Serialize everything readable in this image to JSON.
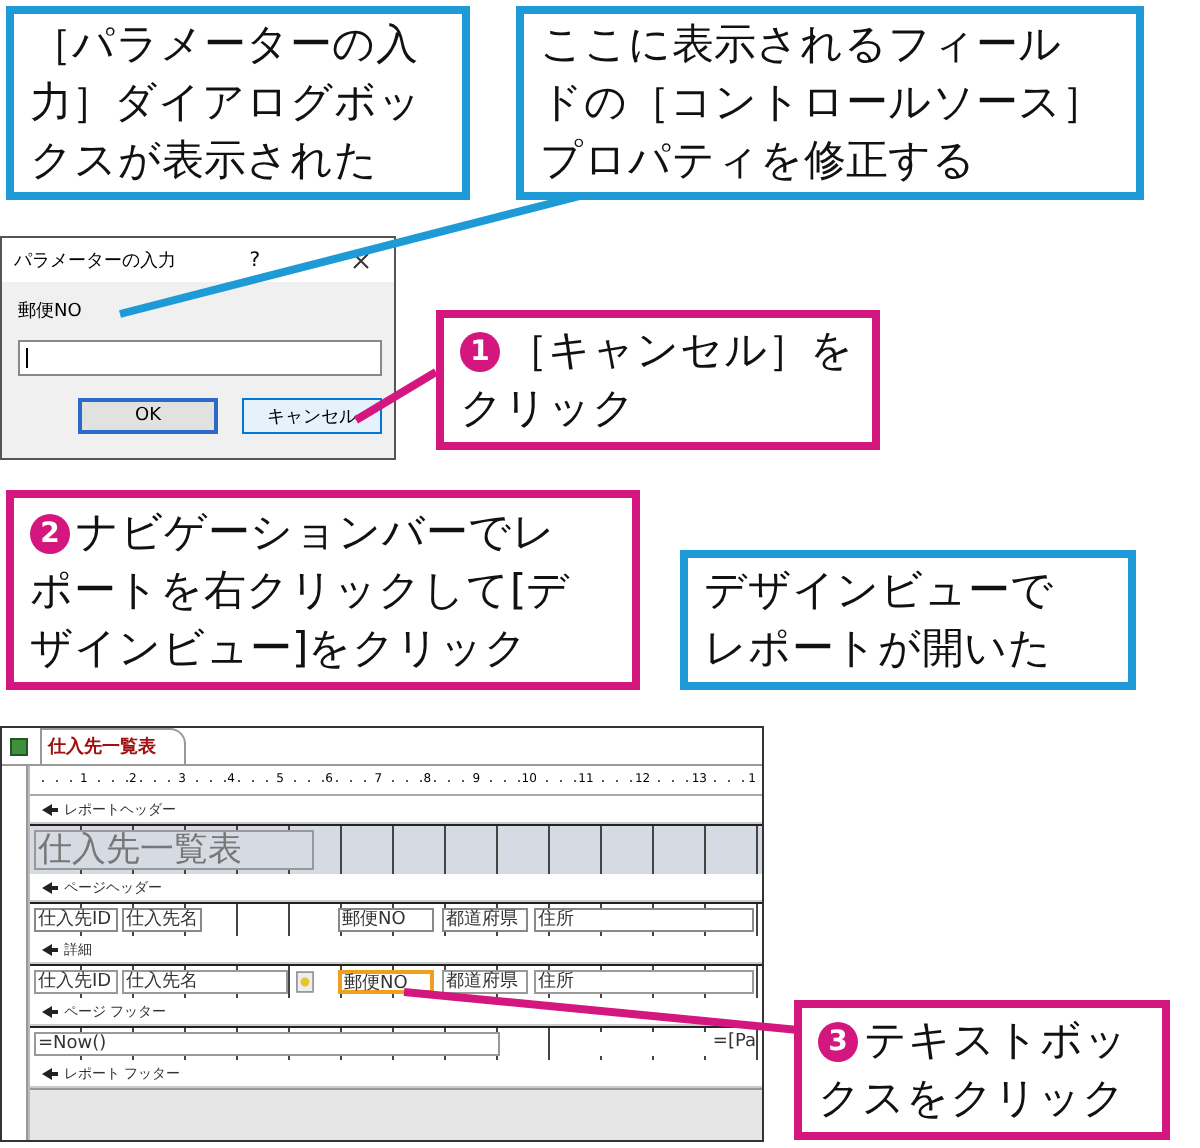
{
  "dialog": {
    "title": "パラメーターの入力",
    "help": "?",
    "label": "郵便NO",
    "buttons": [
      {
        "label": "OK",
        "selected": false
      },
      {
        "label": "キャンセル",
        "selected": true
      }
    ]
  },
  "report": {
    "tab": "仕入先一覧表",
    "ruler": [
      "1",
      "2",
      "3",
      "4",
      "5",
      "6",
      "7",
      "8",
      "9",
      "10",
      "11",
      "12",
      "13",
      "1"
    ],
    "sections": [
      {
        "kind": "bar",
        "label": "レポートヘッダー"
      },
      {
        "kind": "band",
        "shade": true,
        "controls": [
          {
            "kind": "title",
            "text": "仕入先一覧表",
            "selected": false
          }
        ]
      },
      {
        "kind": "bar",
        "label": "ページヘッダー"
      },
      {
        "kind": "band",
        "shade": false,
        "controls": [
          {
            "kind": "label",
            "text": "仕入先ID",
            "selected": false
          },
          {
            "kind": "label",
            "text": "仕入先名",
            "selected": false
          },
          {
            "kind": "label",
            "text": "郵便NO",
            "selected": false
          },
          {
            "kind": "label",
            "text": "都道府県",
            "selected": false
          },
          {
            "kind": "label",
            "text": "住所",
            "selected": false
          }
        ]
      },
      {
        "kind": "bar",
        "label": "詳細"
      },
      {
        "kind": "band",
        "shade": false,
        "controls": [
          {
            "kind": "textbox",
            "text": "仕入先ID",
            "selected": false
          },
          {
            "kind": "textbox",
            "text": "仕入先名",
            "selected": false
          },
          {
            "kind": "image",
            "selected": false
          },
          {
            "kind": "textbox",
            "text": "郵便NO",
            "selected": true
          },
          {
            "kind": "textbox",
            "text": "都道府県",
            "selected": false
          },
          {
            "kind": "textbox",
            "text": "住所",
            "selected": false
          }
        ]
      },
      {
        "kind": "bar",
        "label": "ページ フッター"
      },
      {
        "kind": "band",
        "shade": false,
        "controls": [
          {
            "kind": "textbox",
            "text": "=Now()",
            "selected": false
          },
          {
            "kind": "textbox",
            "text": "=[Pa",
            "selected": false
          }
        ]
      },
      {
        "kind": "bar",
        "label": "レポート フッター"
      }
    ]
  },
  "callouts": [
    {
      "color": "#1e9ad6",
      "lines": [
        "［パラメーターの入",
        "力］ダイアログボッ",
        "クスが表示された"
      ]
    },
    {
      "color": "#1e9ad6",
      "lines": [
        "ここに表示されるフィール",
        "ドの［コントロールソース］",
        "プロパティを修正する"
      ]
    },
    {
      "color": "#d4167f",
      "badge": "1",
      "lines": [
        "［キャンセル］を",
        "クリック"
      ]
    },
    {
      "color": "#d4167f",
      "badge": "2",
      "lines": [
        "ナビゲーションバーでレ",
        "ポートを右クリックして[デ",
        "ザインビュー]をクリック"
      ]
    },
    {
      "color": "#1e9ad6",
      "lines": [
        "デザインビューで",
        "レポートが開いた"
      ]
    },
    {
      "color": "#d4167f",
      "badge": "3",
      "lines": [
        "テキストボッ",
        "クスをクリック"
      ]
    }
  ]
}
